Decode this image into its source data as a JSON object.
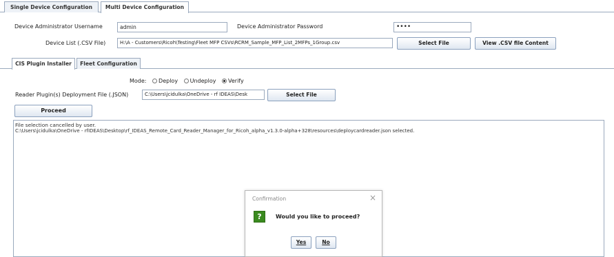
{
  "top_tabs": [
    {
      "label": "Single Device Configuration",
      "active": false
    },
    {
      "label": "Multi Device Configuration",
      "active": true
    }
  ],
  "admin": {
    "username_label": "Device Administrator Username",
    "username_value": "admin",
    "password_label": "Device Administrator Password",
    "password_value": "••••"
  },
  "device_list": {
    "label": "Device List (.CSV File)",
    "value": "H:\\A - Customers\\Ricoh\\Testing\\Fleet MFP CSVs\\RCRM_Sample_MFP_List_2MFPs_1Group.csv",
    "select_button": "Select File",
    "view_button": "View .CSV file Content"
  },
  "sub_tabs": [
    {
      "label": "CIS Plugin Installer",
      "active": true
    },
    {
      "label": "Fleet Configuration",
      "active": false
    }
  ],
  "mode": {
    "label": "Mode:",
    "options": [
      {
        "label": "Deploy",
        "selected": false
      },
      {
        "label": "Undeploy",
        "selected": false
      },
      {
        "label": "Verify",
        "selected": true
      }
    ]
  },
  "reader_plugin": {
    "label": "Reader Plugin(s) Deployment File (.JSON)",
    "value": "C:\\Users\\jcidulka\\OneDrive - rf IDEAS\\Desk",
    "select_button": "Select File"
  },
  "proceed_button": "Proceed",
  "log_lines": [
    "File selection cancelled by user.",
    "C:\\Users\\jcidulka\\OneDrive - rfIDEAS\\Desktop\\rf_IDEAS_Remote_Card_Reader_Manager_for_Ricoh_alpha_v1.3.0-alpha+328\\resources\\deploycardreader.json selected."
  ],
  "dialog": {
    "title": "Confirmation",
    "close": "×",
    "icon": "question-icon",
    "icon_glyph": "?",
    "message": "Would you like to proceed?",
    "yes": "Yes",
    "no": "No",
    "icon_color": "#3a8a1f"
  }
}
